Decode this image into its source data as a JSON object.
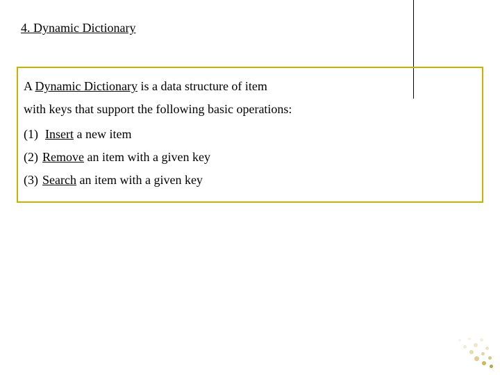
{
  "title": "4. Dynamic Dictionary",
  "defn": {
    "lead": "A ",
    "term": "Dynamic Dictionary",
    "mid": " is a data structure of item",
    "line2": "with keys that support the following basic operations:"
  },
  "ops": [
    {
      "num": "(1)",
      "verb": "Insert",
      "rest": " a new item"
    },
    {
      "num": "(2)",
      "verb": "Remove",
      "rest": " an item with a given key"
    },
    {
      "num": "(3)",
      "verb": "Search",
      "rest": " an item with a given key"
    }
  ]
}
